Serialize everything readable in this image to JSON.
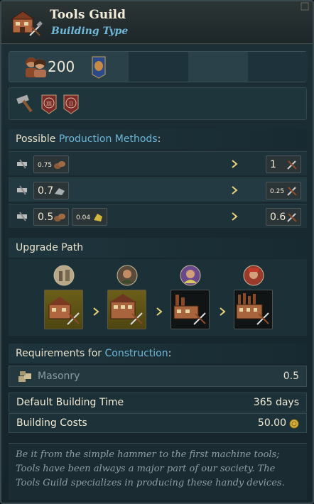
{
  "header": {
    "title": "Tools Guild",
    "subtitle": "Building Type"
  },
  "stats": {
    "population": "200"
  },
  "production": {
    "heading_prefix": "Possible ",
    "heading_highlight": "Production Methods",
    "heading_suffix": ":",
    "rows": [
      {
        "inputs": [
          {
            "value": "0.75",
            "small": true,
            "icon": "wood-icon"
          }
        ],
        "output": {
          "value": "1",
          "small": false,
          "icon": "tools-icon"
        }
      },
      {
        "inputs": [
          {
            "value": "0.7",
            "small": false,
            "icon": "iron-icon"
          }
        ],
        "output": {
          "value": "0.25",
          "small": true,
          "icon": "tools-icon"
        }
      },
      {
        "inputs": [
          {
            "value": "0.5",
            "small": false,
            "icon": "wood-icon"
          },
          {
            "value": "0.04",
            "small": true,
            "icon": "gold-icon"
          }
        ],
        "output": {
          "value": "0.6",
          "small": false,
          "icon": "tools-icon"
        }
      }
    ]
  },
  "upgrade": {
    "heading": "Upgrade Path"
  },
  "requirements": {
    "heading_prefix": "Requirements for ",
    "heading_highlight": "Construction",
    "heading_suffix": ":",
    "item_label": "Masonry",
    "item_value": "0.5"
  },
  "info": {
    "build_time_label": "Default Building Time",
    "build_time_value": "365 days",
    "costs_label": "Building Costs",
    "costs_value": "50.00"
  },
  "description": "Be it from the simple hammer to the first machine tools; Tools have been always a major part of our society. The Tools Guild specializes in producing these handy devices.",
  "colors": {
    "accent": "#6fb8d9",
    "gold_card": "#6c5f1a",
    "badge_red": "#7a2a2a"
  }
}
